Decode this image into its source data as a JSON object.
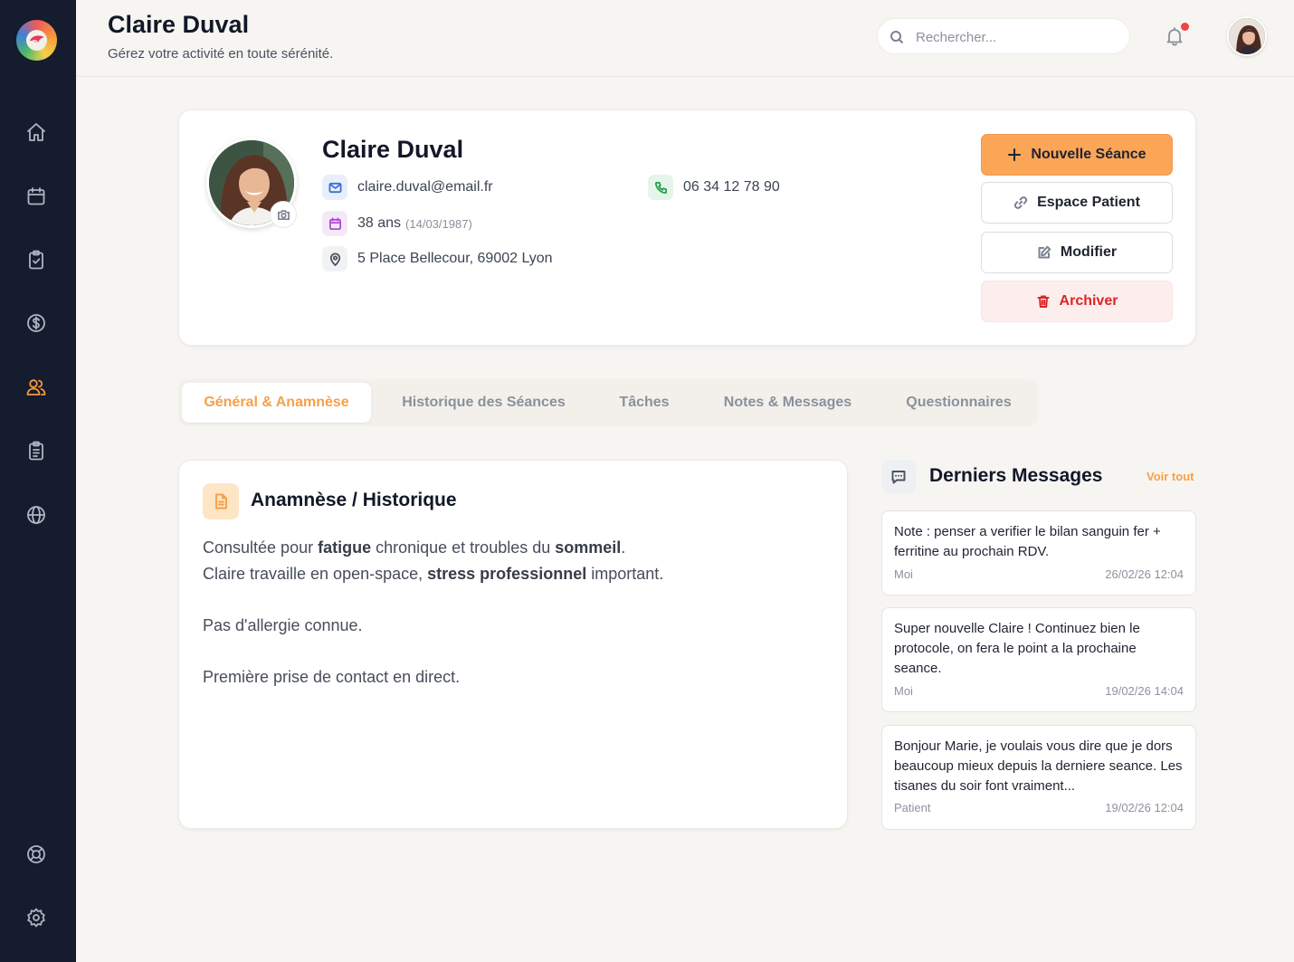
{
  "header": {
    "title": "Claire Duval",
    "subtitle": "Gérez votre activité en toute sérénité.",
    "search_placeholder": "Rechercher..."
  },
  "sidebar": {
    "items": [
      {
        "icon": "home-icon"
      },
      {
        "icon": "calendar-icon"
      },
      {
        "icon": "clipboard-check-icon"
      },
      {
        "icon": "dollar-icon"
      },
      {
        "icon": "users-icon",
        "active": true
      },
      {
        "icon": "clipboard-list-icon"
      },
      {
        "icon": "globe-icon"
      },
      {
        "icon": "lifebuoy-icon"
      },
      {
        "icon": "settings-icon"
      }
    ]
  },
  "profile": {
    "name": "Claire Duval",
    "email": "claire.duval@email.fr",
    "phone": "06 34 12 78 90",
    "age": "38 ans",
    "birthdate": "(14/03/1987)",
    "address": "5 Place Bellecour, 69002 Lyon"
  },
  "actions": {
    "new_session": "Nouvelle Séance",
    "patient_space": "Espace Patient",
    "edit": "Modifier",
    "archive": "Archiver"
  },
  "tabs": [
    {
      "label": "Général & Anamnèse",
      "active": true
    },
    {
      "label": "Historique des Séances"
    },
    {
      "label": "Tâches"
    },
    {
      "label": "Notes & Messages"
    },
    {
      "label": "Questionnaires"
    }
  ],
  "anamnese": {
    "title": "Anamnèse / Historique",
    "line1": {
      "a": "Consultée pour ",
      "b": "fatigue",
      "c": " chronique et troubles du ",
      "d": "sommeil",
      "e": "."
    },
    "line2": {
      "a": "Claire travaille en open-space, ",
      "b": "stress professionnel",
      "c": " important."
    },
    "line3": "Pas d'allergie connue.",
    "line4": "Première prise de contact en direct."
  },
  "messages": {
    "title": "Derniers Messages",
    "see_all": "Voir tout",
    "items": [
      {
        "text": "Note : penser a verifier le bilan sanguin fer + ferritine au prochain RDV.",
        "author": "Moi",
        "date": "26/02/26 12:04"
      },
      {
        "text": "Super nouvelle Claire ! Continuez bien le protocole, on fera le point a la prochaine seance.",
        "author": "Moi",
        "date": "19/02/26 14:04"
      },
      {
        "text": "Bonjour Marie, je voulais vous dire que je dors beaucoup mieux depuis la derniere seance. Les tisanes du soir font vraiment...",
        "author": "Patient",
        "date": "19/02/26 12:04"
      }
    ]
  },
  "colors": {
    "accent": "#f6a049",
    "sidebar": "#141c2d",
    "danger": "#dc2626"
  }
}
